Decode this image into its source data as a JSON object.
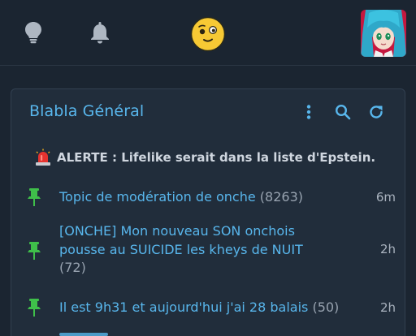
{
  "topbar": {
    "icons": [
      "lightbulb-icon",
      "bell-icon",
      "smiley-icon"
    ],
    "avatar_alt": "user-avatar"
  },
  "card": {
    "title": "Blabla Général",
    "actions": [
      "more-vertical-icon",
      "search-icon",
      "refresh-icon"
    ],
    "alert": {
      "icon": "siren-icon",
      "text": "ALERTE : Lifelike serait dans la liste d'Epstein."
    },
    "topics": [
      {
        "title": "Topic de modération de onche",
        "count": "(8263)",
        "time": "6m",
        "pinned": true
      },
      {
        "title": "[ONCHE] Mon nouveau SON onchois pousse au SUICIDE les kheys de NUIT",
        "count": "(72)",
        "time": "2h",
        "pinned": true
      },
      {
        "title": "Il est 9h31 et aujourd'hui j'ai 28 balais",
        "count": "(50)",
        "time": "2h",
        "pinned": true
      }
    ]
  },
  "colors": {
    "background": "#1b2531",
    "card": "#212d3b",
    "accent": "#58b6ec",
    "pin": "#3fbf4a",
    "smiley": "#f7c934"
  }
}
